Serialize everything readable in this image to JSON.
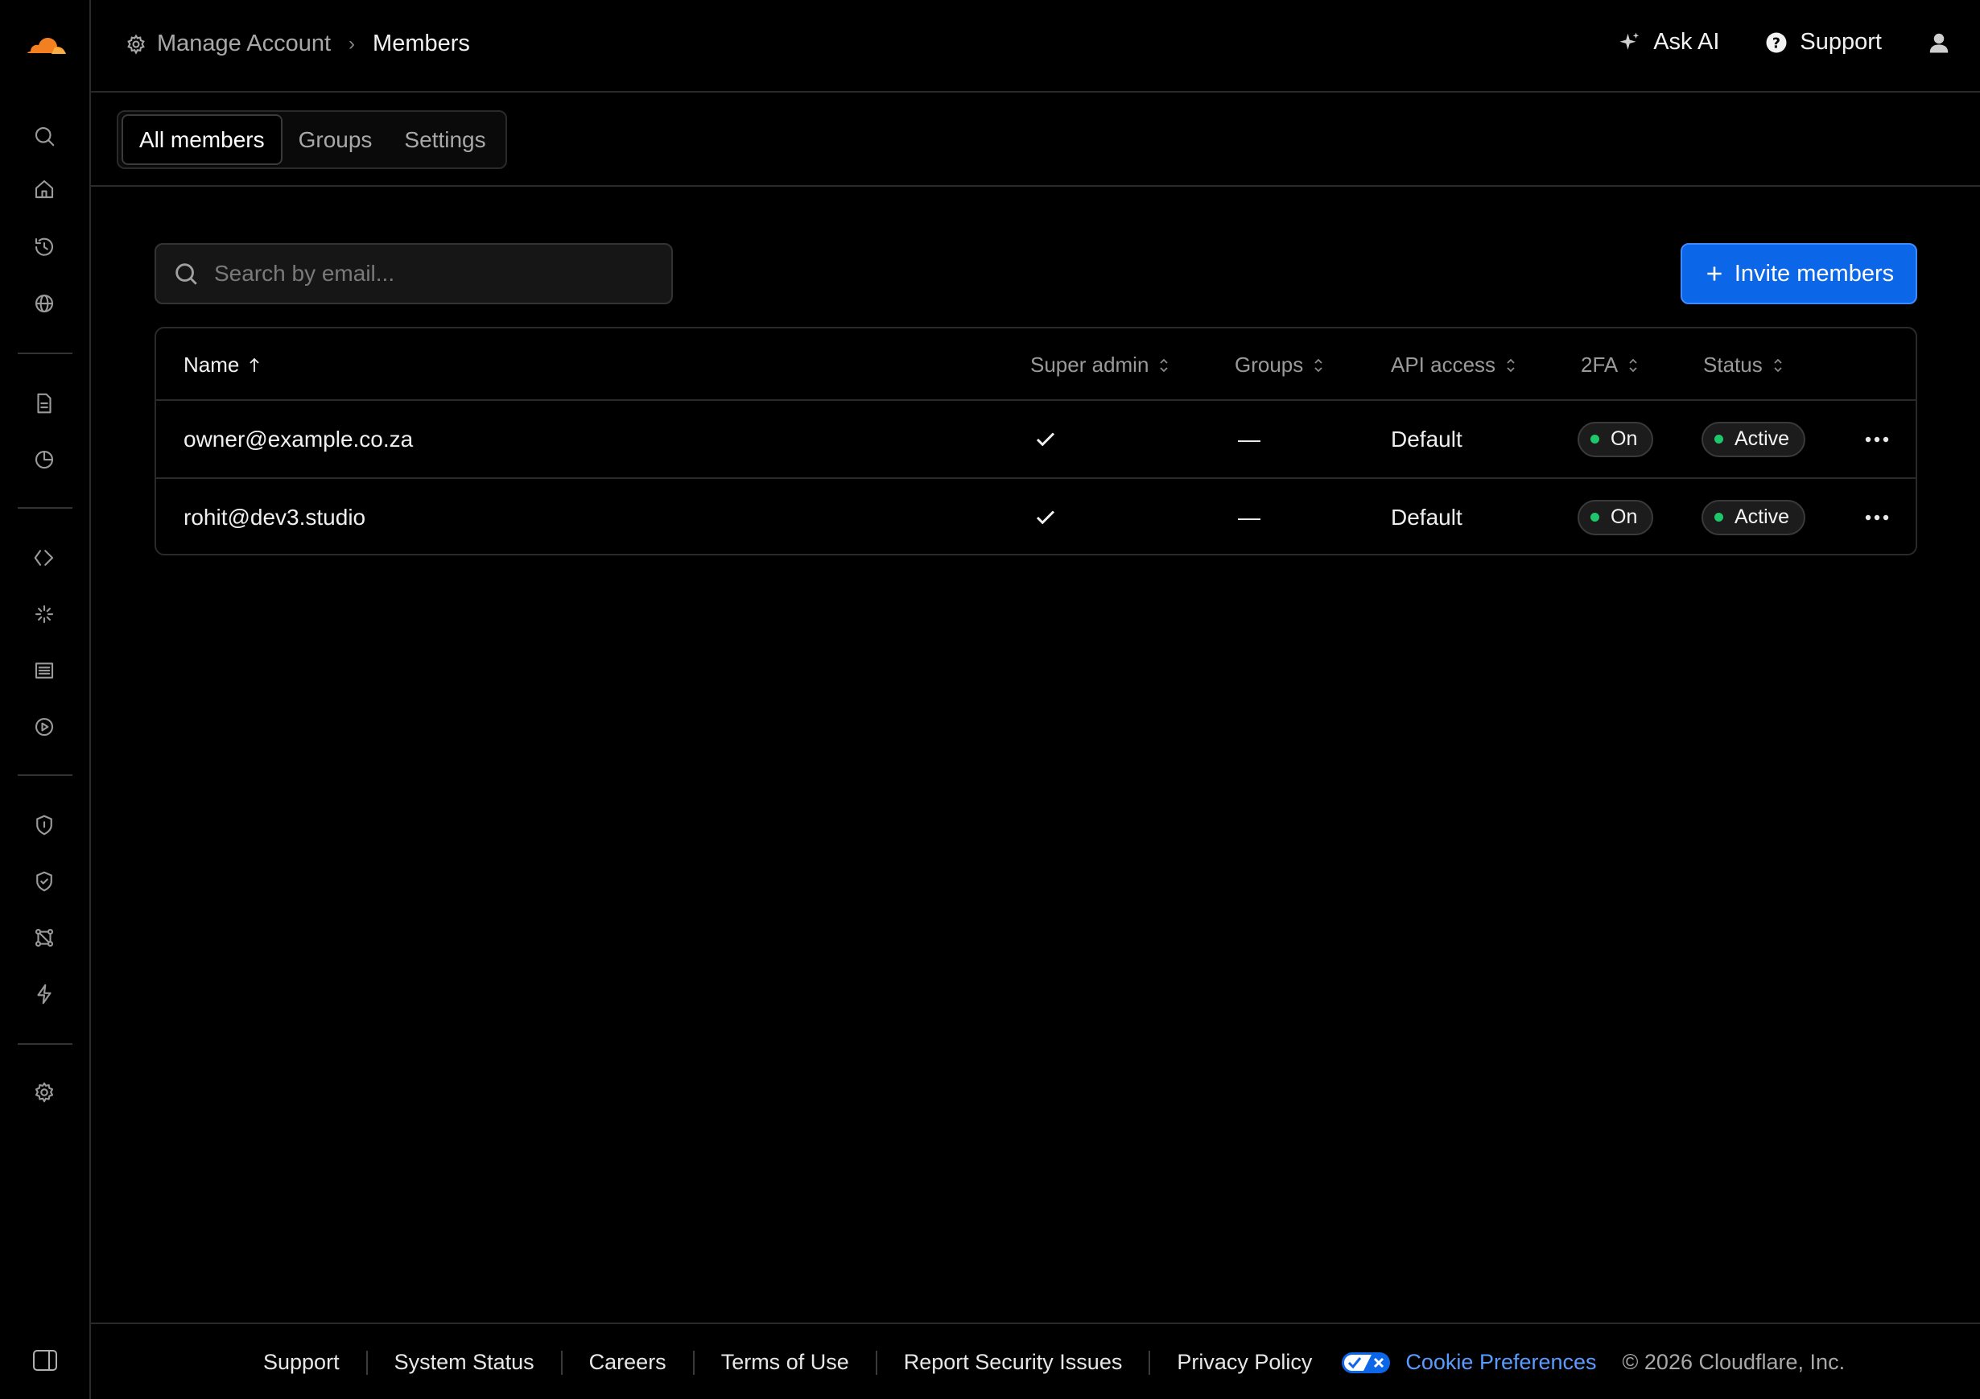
{
  "header": {
    "breadcrumb_parent": "Manage Account",
    "breadcrumb_current": "Members",
    "ask_ai": "Ask AI",
    "support": "Support"
  },
  "tabs": [
    {
      "label": "All members",
      "active": true
    },
    {
      "label": "Groups",
      "active": false
    },
    {
      "label": "Settings",
      "active": false
    }
  ],
  "search": {
    "placeholder": "Search by email...",
    "value": ""
  },
  "invite_label": "Invite members",
  "table": {
    "columns": [
      "Name",
      "Super admin",
      "Groups",
      "API access",
      "2FA",
      "Status"
    ],
    "rows": [
      {
        "name": "owner@example.co.za",
        "super_admin": true,
        "groups": "—",
        "api_access": "Default",
        "twofa": "On",
        "status": "Active"
      },
      {
        "name": "rohit@dev3.studio",
        "super_admin": true,
        "groups": "—",
        "api_access": "Default",
        "twofa": "On",
        "status": "Active"
      }
    ]
  },
  "sidebar_icons": [
    "search-icon",
    "home-icon",
    "history-icon",
    "globe-icon",
    "document-icon",
    "chart-pie-icon",
    "code-icon",
    "sparkle-icon",
    "list-icon",
    "play-icon",
    "shield-icon",
    "shield-check-icon",
    "network-icon",
    "bolt-icon",
    "gear-icon"
  ],
  "footer": {
    "links": [
      "Support",
      "System Status",
      "Careers",
      "Terms of Use",
      "Report Security Issues",
      "Privacy Policy"
    ],
    "cookie_preferences": "Cookie Preferences",
    "copyright": "© 2026 Cloudflare, Inc."
  },
  "colors": {
    "accent": "#0b66e8",
    "status_green": "#1ec76b",
    "cloudflare_orange": "#f38020"
  }
}
